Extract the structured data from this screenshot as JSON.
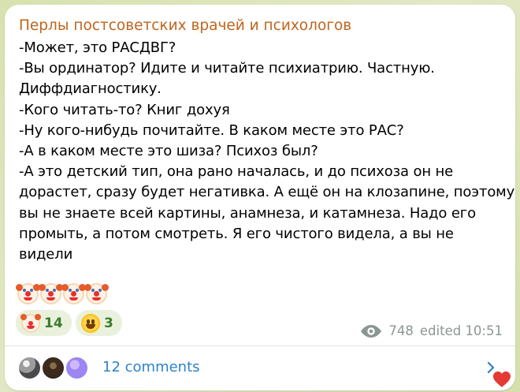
{
  "channel": {
    "name": "Перлы постсоветских врачей и психологов"
  },
  "message": {
    "lines": [
      "-Может, это РАСДВГ?",
      "-Вы ординатор? Идите и читайте психиатрию. Частную.",
      "Диффдиагностику.",
      "-Кого читать-то? Книг дохуя",
      "-Ну кого-нибудь почитайте. В каком месте это РАС?",
      "-А в каком месте это шиза? Психоз был?",
      "-А это детский тип, она рано началась, и до психоза он не",
      "дорастет, сразу будет негативка. А ещё он на клозапине, поэтому",
      "вы не знаете всей картины, анамнеза, и катамнеза. Надо его",
      "промыть, а потом смотреть. Я его чистого видела, а вы не",
      "видели"
    ]
  },
  "emoji_row": {
    "icons": [
      "clown-icon",
      "clown-icon",
      "clown-icon",
      "clown-icon"
    ]
  },
  "reactions": [
    {
      "emoji": "clown-icon",
      "count": "14"
    },
    {
      "emoji": "grinning-icon",
      "count": "3"
    }
  ],
  "meta": {
    "views": "748",
    "edited": "edited 10:51"
  },
  "comments": {
    "label": "12 comments"
  },
  "colors": {
    "channel": "#c0651c",
    "link": "#2b82c9",
    "reaction_bg": "#e9f1dc",
    "reaction_text": "#3a7b2b"
  }
}
